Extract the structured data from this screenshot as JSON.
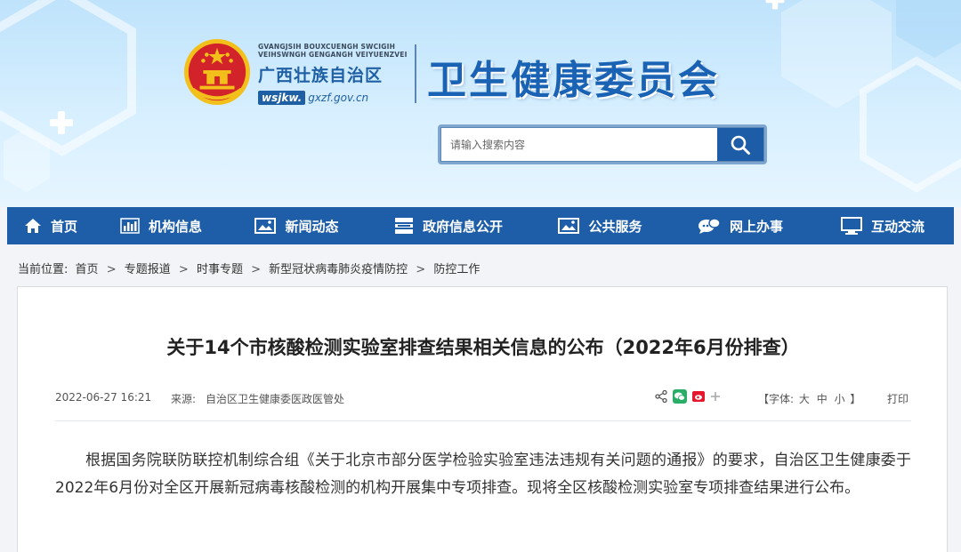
{
  "header": {
    "gov_latin_1": "GVANGJSIH BOUXCUENGH SWCIGIH",
    "gov_latin_2": "VEIHSWNGH GENGANGH VEIYUENZVEI",
    "gov_name": "广西壮族自治区",
    "site_prefix": "wsjkw.",
    "site_suffix": "gxzf.gov.cn",
    "org_title": "卫生健康委员会",
    "search_placeholder": "请输入搜索内容"
  },
  "nav": {
    "items": [
      {
        "label": "首页",
        "icon": "home-icon"
      },
      {
        "label": "机构信息",
        "icon": "bar-chart-icon"
      },
      {
        "label": "新闻动态",
        "icon": "picture-icon"
      },
      {
        "label": "政府信息公开",
        "icon": "list-icon"
      },
      {
        "label": "公共服务",
        "icon": "picture-icon"
      },
      {
        "label": "网上办事",
        "icon": "chat-icon"
      },
      {
        "label": "互动交流",
        "icon": "monitor-icon"
      }
    ]
  },
  "breadcrumb": {
    "prefix": "当前位置:",
    "items": [
      "首页",
      "专题报道",
      "时事专题",
      "新型冠状病毒肺炎疫情防控",
      "防控工作"
    ],
    "separator": ">"
  },
  "article": {
    "title": "关于14个市核酸检测实验室排查结果相关信息的公布（2022年6月份排查）",
    "date": "2022-06-27 16:21",
    "source_label": "来源:",
    "source": "自治区卫生健康委医政医管处",
    "font_label_open": "【字体:",
    "font_large": "大",
    "font_medium": "中",
    "font_small": "小",
    "font_label_close": "】",
    "print": "打印",
    "share_icons": [
      "share-icon",
      "wechat-icon",
      "weibo-icon",
      "more-icon"
    ],
    "body": "根据国务院联防联控机制综合组《关于北京市部分医学检验实验室违法违规有关问题的通报》的要求，自治区卫生健康委于2022年6月份对全区开展新冠病毒核酸检测的机构开展集中专项排查。现将全区核酸检测实验室专项排查结果进行公布。"
  },
  "colors": {
    "nav_bg": "#1e5ea8",
    "brand_blue": "#1a62b3",
    "banner_light": "#d7efff",
    "emblem_red": "#d2232a",
    "emblem_gold": "#f3c01b"
  }
}
